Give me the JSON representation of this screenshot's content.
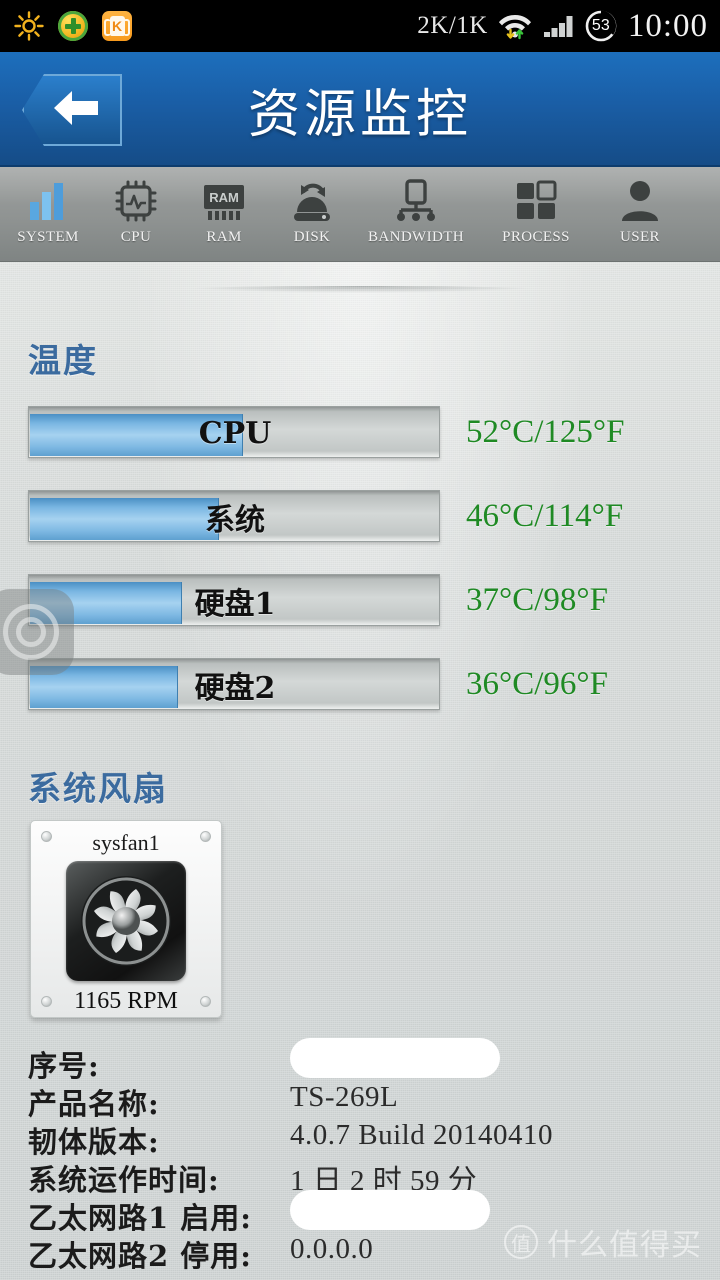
{
  "statusbar": {
    "icons_left": [
      "brightness-sun-icon",
      "security-plus-icon",
      "kugou-music-icon"
    ],
    "app_letter": "K",
    "network_speed": "2K/1K",
    "battery_level": "53",
    "time": "10:00",
    "icons_right": [
      "wifi-icon",
      "signal-icon",
      "battery-icon"
    ]
  },
  "titlebar": {
    "back_icon": "back-arrow-icon",
    "title": "资源监控"
  },
  "tabs": [
    {
      "label": "SYSTEM",
      "icon": "bar-chart-icon",
      "active": true
    },
    {
      "label": "CPU",
      "icon": "cpu-chip-icon",
      "active": false
    },
    {
      "label": "RAM",
      "icon": "ram-module-icon",
      "active": false
    },
    {
      "label": "DISK",
      "icon": "disk-sync-icon",
      "active": false
    },
    {
      "label": "BANDWIDTH",
      "icon": "network-icon",
      "active": false
    },
    {
      "label": "PROCESS",
      "icon": "grid-tiles-icon",
      "active": false
    },
    {
      "label": "USER",
      "icon": "person-icon",
      "active": false
    }
  ],
  "temperature": {
    "heading": "温度",
    "rows": [
      {
        "label": "CPU",
        "value": "52°C/125°F",
        "percent": 52
      },
      {
        "label": "系统",
        "value": "46°C/114°F",
        "percent": 46
      },
      {
        "label": "硬盘1",
        "value": "37°C/98°F",
        "percent": 37
      },
      {
        "label": "硬盘2",
        "value": "36°C/96°F",
        "percent": 36
      }
    ],
    "value_color": "#1f8a24"
  },
  "fans": {
    "heading": "系统风扇",
    "items": [
      {
        "name": "sysfan1",
        "rpm": "1165 RPM",
        "icon": "fan-icon"
      }
    ]
  },
  "info": {
    "rows": [
      {
        "key": "序号:",
        "value": "",
        "redacted": true,
        "redact_width": 210
      },
      {
        "key": "产品名称:",
        "value": "TS-269L",
        "redacted": false
      },
      {
        "key": "韧体版本:",
        "value": "4.0.7 Build 20140410",
        "redacted": false
      },
      {
        "key": "系统运作时间:",
        "value": "1 日 2 时 59 分",
        "redacted": false
      },
      {
        "key": "乙太网路1 启用:",
        "value": "",
        "redacted": true,
        "redact_width": 200
      },
      {
        "key": "乙太网路2 停用:",
        "value": "0.0.0.0",
        "redacted": false
      }
    ]
  },
  "floating_button": {
    "icon": "assistive-touch-icon"
  },
  "watermark": {
    "logo_char": "值",
    "text": "什么值得买"
  },
  "colors": {
    "titlebar": "#1a5ea6",
    "accent_blue": "#3b6b9f",
    "bar_fill": "#7fb9e3",
    "temp_green": "#1f8a24",
    "background": "#d6dad9"
  }
}
